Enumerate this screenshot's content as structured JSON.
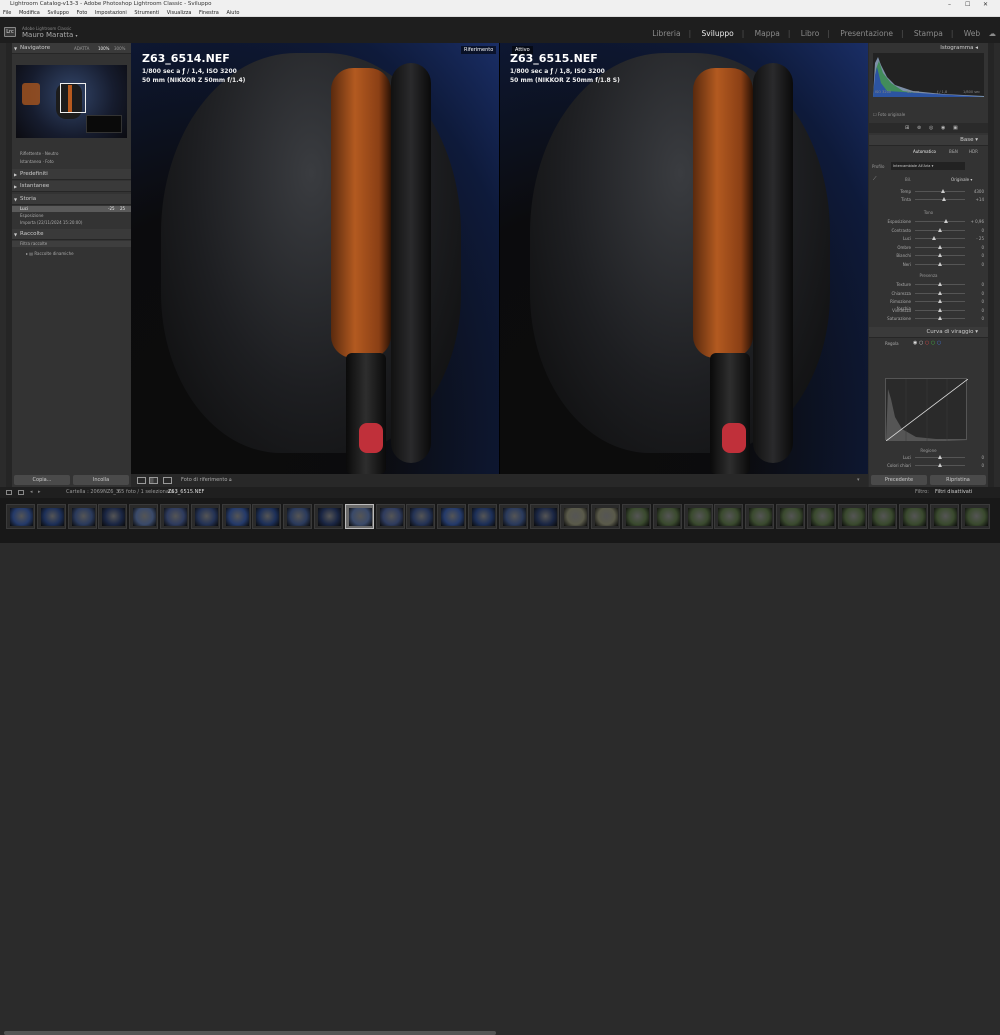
{
  "window": {
    "title": "Lightroom Catalog-v13-3 - Adobe Photoshop Lightroom Classic - Sviluppo",
    "controls": [
      "–",
      "☐",
      "✕"
    ]
  },
  "menu": [
    "File",
    "Modifica",
    "Sviluppo",
    "Foto",
    "Impostazioni",
    "Strumenti",
    "Visualizza",
    "Finestra",
    "Aiuto"
  ],
  "identity": {
    "badge": "Lrc",
    "app_sub": "Adobe Lightroom Classic",
    "user": "Mauro Maratta",
    "modules": [
      "Libreria",
      "Sviluppo",
      "Mappa",
      "Libro",
      "Presentazione",
      "Stampa",
      "Web"
    ],
    "active_module": "Sviluppo"
  },
  "left": {
    "navigator": {
      "title": "Navigatore",
      "zoom": [
        "ADATTA",
        "100%",
        "300%"
      ]
    },
    "histogram_labels": [
      "Riflettente",
      "Neutro",
      "Istantanea",
      "Foto"
    ],
    "panels": [
      "Predefiniti",
      "Istantanee",
      "Storia",
      "Raccolte"
    ],
    "history": [
      {
        "label": "Luci",
        "a": "-25",
        "b": "25"
      },
      {
        "label": "Esposizione",
        "a": "",
        "b": ""
      },
      {
        "label": "Importa (22/11/2024 15:20:00)",
        "a": "",
        "b": ""
      }
    ],
    "collections": [
      "Filtra raccolte",
      "Raccolte dinamiche"
    ],
    "buttons": {
      "copy": "Copia...",
      "paste": "Incolla"
    }
  },
  "center": {
    "left_photo": {
      "tag": "Riferimento",
      "filename": "Z63_6514.NEF",
      "line1": "1/800 sec a ƒ / 1,4, ISO 3200",
      "line2": "50 mm (NIKKOR Z 50mm f/1.4)"
    },
    "right_photo": {
      "tag": "Attivo",
      "filename": "Z63_6515.NEF",
      "line1": "1/800 sec a ƒ / 1,8, ISO 3200",
      "line2": "50 mm (NIKKOR Z 50mm f/1.8 S)"
    },
    "toolbar_label": "Foto di riferimento"
  },
  "right": {
    "histogram_title": "Istogramma",
    "histogram_info": [
      "ISO 3200",
      "50 mm",
      "ƒ / 1,8",
      "1/800 sec"
    ],
    "original_photo": "Foto originale",
    "base_title": "Base",
    "treatment": [
      "Automatico",
      "B&N",
      "HDR"
    ],
    "profile_label": "Profilo",
    "profile_value": "Intercambiale All'Aria",
    "wb": {
      "label": "Bil.",
      "value": "Originale"
    },
    "temp": [
      {
        "label": "Temp",
        "val": "4300",
        "pos": 0.55
      },
      {
        "label": "Tinta",
        "val": "+14",
        "pos": 0.58
      }
    ],
    "tone_section": "Tono",
    "tone": [
      {
        "label": "Esposizione",
        "val": "+ 0,96",
        "pos": 0.62
      },
      {
        "label": "Contrasto",
        "val": "0",
        "pos": 0.5
      },
      {
        "label": "Luci",
        "val": "- 25",
        "pos": 0.38
      },
      {
        "label": "Ombre",
        "val": "0",
        "pos": 0.5
      },
      {
        "label": "Bianchi",
        "val": "0",
        "pos": 0.5
      },
      {
        "label": "Neri",
        "val": "0",
        "pos": 0.5
      }
    ],
    "presence_section": "Presenza",
    "presence": [
      {
        "label": "Texture",
        "val": "0",
        "pos": 0.5
      },
      {
        "label": "Chiarezza",
        "val": "0",
        "pos": 0.5
      },
      {
        "label": "Rimozione foschia",
        "val": "0",
        "pos": 0.5
      },
      {
        "label": "Vividezza",
        "val": "0",
        "pos": 0.5
      },
      {
        "label": "Saturazione",
        "val": "0",
        "pos": 0.5
      }
    ],
    "curve_title": "Curva di viraggio",
    "curve_channel": "Regola",
    "region_label": "Regione",
    "region": [
      {
        "label": "Luci",
        "val": "0",
        "pos": 0.5
      },
      {
        "label": "Colori chiari",
        "val": "0",
        "pos": 0.5
      }
    ],
    "buttons": {
      "prev": "Precedente",
      "reset": "Ripristina"
    }
  },
  "filmstrip": {
    "info": "Cartella : 2069NZ6_3",
    "count": "65 foto / 1 selezionata /",
    "current": "Z63_6515.NEF",
    "filter_label": "Filtro:",
    "filter_value": "Filtri disattivati"
  }
}
